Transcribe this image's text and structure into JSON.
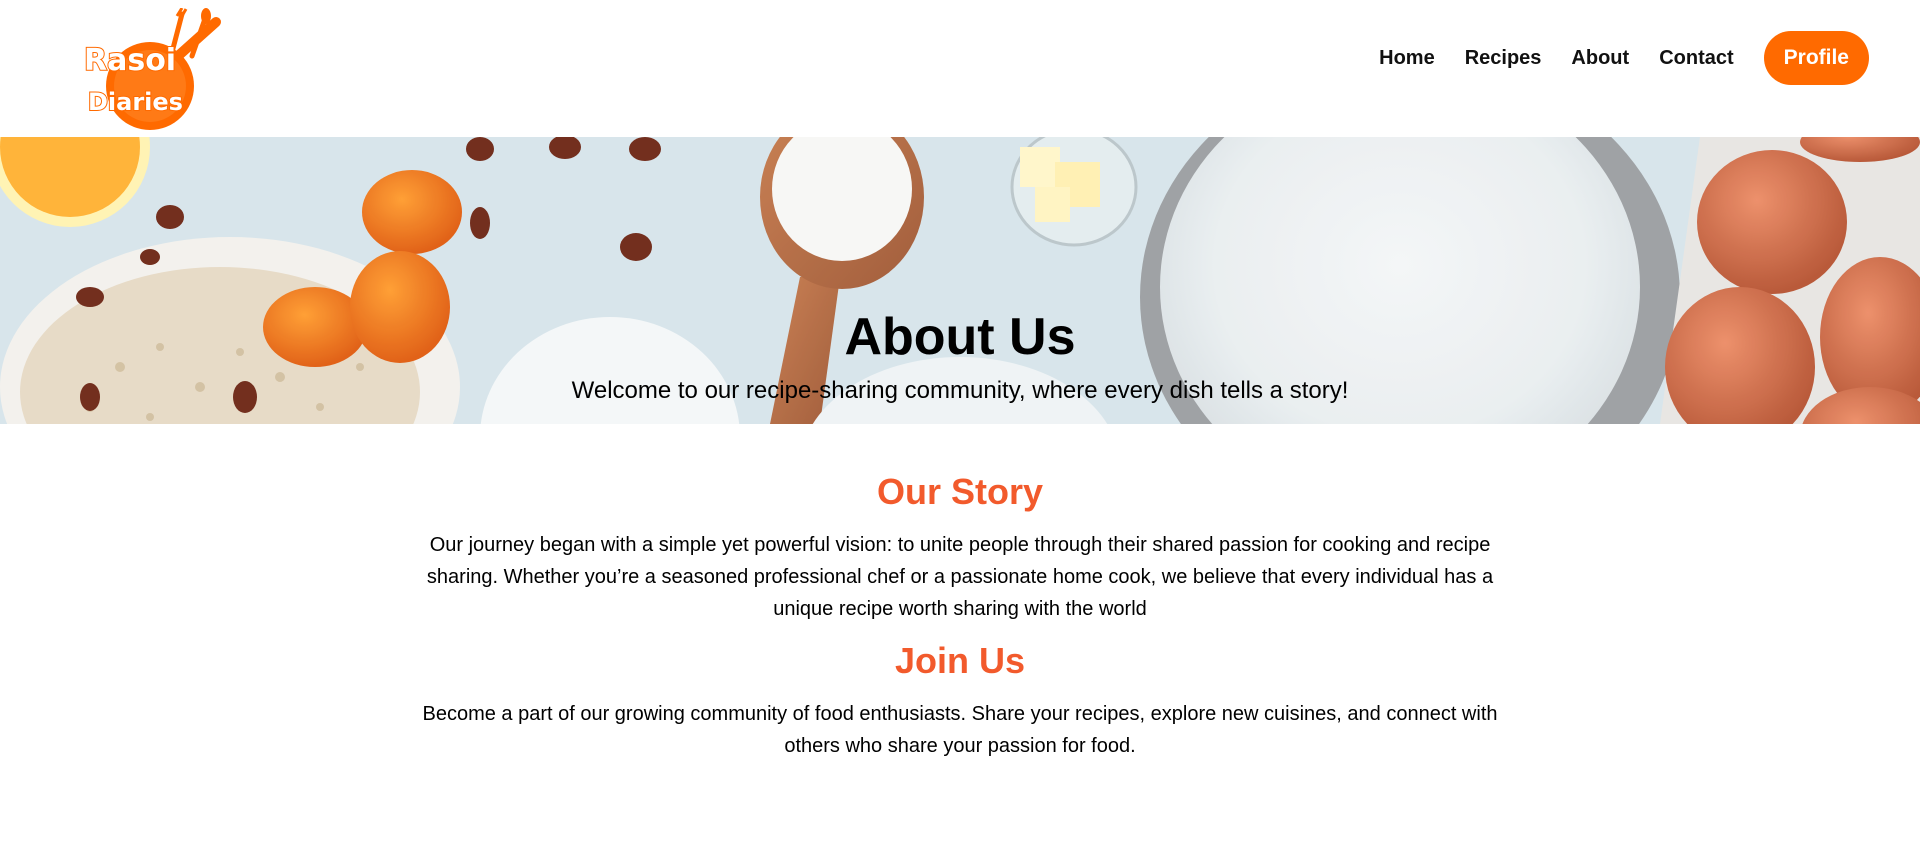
{
  "brand": {
    "logo_line1": "Rasoi",
    "logo_line2": "Diaries"
  },
  "nav": {
    "items": [
      {
        "label": "Home"
      },
      {
        "label": "Recipes"
      },
      {
        "label": "About"
      },
      {
        "label": "Contact"
      }
    ],
    "profile_label": "Profile"
  },
  "hero": {
    "title": "About Us",
    "subtitle": "Welcome to our recipe-sharing community, where every dish tells a story!"
  },
  "story": {
    "title": "Our Story",
    "text": "Our journey began with a simple yet powerful vision: to unite people through their shared passion for cooking and recipe sharing. Whether you’re a seasoned professional chef or a passionate home cook, we believe that every individual has a unique recipe worth sharing with the world"
  },
  "join": {
    "title": "Join Us",
    "text": "Become a part of our growing community of food enthusiasts. Share your recipes, explore new cuisines, and connect with others who share your passion for food."
  },
  "colors": {
    "accent": "#ff6a00",
    "heading": "#f25a2c"
  }
}
